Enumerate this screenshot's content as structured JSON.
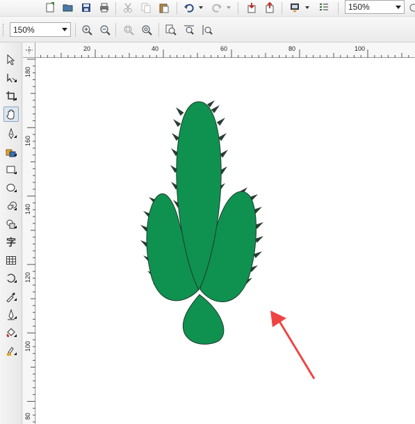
{
  "toolbar": {
    "zoom_value": "150%",
    "icons": [
      "new-document-icon",
      "open-folder-icon",
      "save-icon",
      "print-icon",
      "cut-icon",
      "copy-icon",
      "paste-icon",
      "undo-icon",
      "redo-icon",
      "import-icon",
      "export-icon",
      "publish-icon",
      "application-launcher-icon"
    ]
  },
  "zoom_bar": {
    "zoom_value": "150%",
    "icons": [
      "zoom-in-icon",
      "zoom-out-icon",
      "zoom-to-selected-icon",
      "zoom-to-fit-icon",
      "zoom-to-page-icon",
      "zoom-to-page-width-icon",
      "zoom-to-page-height-icon"
    ]
  },
  "toolbox": {
    "tools": [
      "pick-tool-icon",
      "shape-tool-icon",
      "crop-tool-icon",
      "pan-tool-icon",
      "freehand-tool-icon",
      "smart-fill-tool-icon",
      "rectangle-tool-icon",
      "ellipse-tool-icon",
      "spiral-tool-icon",
      "basic-shapes-tool-icon",
      "text-tool-icon",
      "table-tool-icon",
      "blend-tool-icon",
      "eyedropper-tool-icon",
      "outline-tool-icon",
      "fill-tool-icon",
      "interactive-fill-tool-icon"
    ],
    "active_tool": "pan-tool-icon",
    "text_tool_glyph": "字"
  },
  "ruler": {
    "unit_labels_h": [
      "20",
      "40",
      "60",
      "80",
      "100"
    ],
    "unit_labels_v": [
      "180",
      "160",
      "140",
      "120",
      "100",
      "80"
    ]
  },
  "colors": {
    "shape_fill": "#0f9150",
    "shape_stroke": "#1d3b2c",
    "arrow": "#ef4444"
  }
}
